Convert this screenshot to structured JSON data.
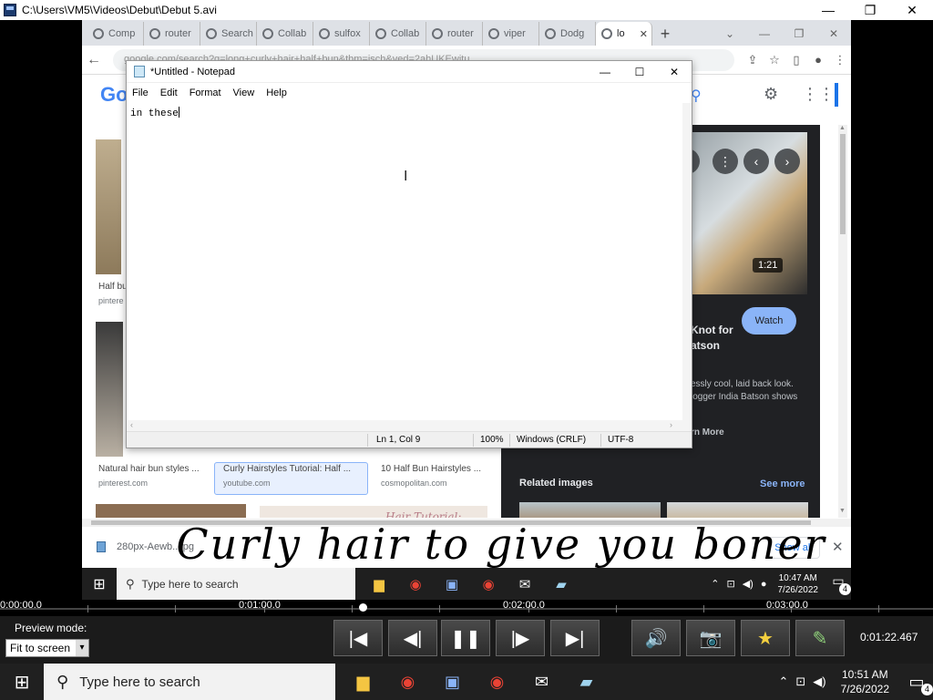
{
  "player": {
    "title": "C:\\Users\\VM5\\Videos\\Debut\\Debut 5.avi",
    "minimize": "—",
    "restore": "❐",
    "close": "✕"
  },
  "browser": {
    "tabs": [
      {
        "label": "Comp",
        "icon": "globe-icon"
      },
      {
        "label": "router",
        "icon": "globe-icon"
      },
      {
        "label": "Search",
        "icon": "globe-icon"
      },
      {
        "label": "Collab",
        "icon": "globe-icon"
      },
      {
        "label": "sulfox",
        "icon": "google-icon"
      },
      {
        "label": "Collab",
        "icon": "globe-icon"
      },
      {
        "label": "router",
        "icon": "globe-icon"
      },
      {
        "label": "viper",
        "icon": "google-icon"
      },
      {
        "label": "Dodg",
        "icon": "wikipedia-icon"
      },
      {
        "label": "lo",
        "icon": "google-icon",
        "active": true
      }
    ],
    "url": "google.com/search?q=long+curly+hair+half+bun&tbm=isch&ved=2ahUKEwitu..."
  },
  "google": {
    "logo": "Go",
    "results": [
      {
        "caption": "Half bu",
        "source": "pintere"
      },
      {
        "caption": "Natural hair bun styles ...",
        "source": "pinterest.com"
      },
      {
        "caption": "Curly Hairstyles Tutorial: Half ...",
        "source": "youtube.com"
      },
      {
        "caption": "10 Half Bun Hairstyles ...",
        "source": "cosmopolitan.com"
      }
    ],
    "thumb_text": "Hair Tutorial:",
    "panel": {
      "duration": "1:21",
      "watch": "Watch",
      "title": "Knot for\natson",
      "description": "essly cool, laid back look. logger India Batson shows",
      "learn_more": "rn More",
      "related": "Related images",
      "see_more": "See more"
    }
  },
  "notepad": {
    "title": "*Untitled - Notepad",
    "menu": [
      "File",
      "Edit",
      "Format",
      "View",
      "Help"
    ],
    "content": "in these",
    "status": {
      "position": "Ln 1, Col 9",
      "zoom": "100%",
      "line_ending": "Windows (CRLF)",
      "encoding": "UTF-8"
    }
  },
  "download": {
    "filename": "280px-Aewb...jpg",
    "show_all": "Show all"
  },
  "subtitle": "Curly hair to give you boner",
  "inner_taskbar": {
    "search_placeholder": "Type here to search",
    "time": "10:47 AM",
    "date": "7/26/2022",
    "notifications": "4"
  },
  "timeline": {
    "labels": [
      "0:00:00.0",
      "0:01:00.0",
      "0:02:00.0",
      "0:03:00.0"
    ],
    "position": "0:01:22.467"
  },
  "controls": {
    "preview_label": "Preview mode:",
    "preview_value": "Fit to screen"
  },
  "outer_taskbar": {
    "search_placeholder": "Type here to search",
    "time": "10:51 AM",
    "date": "7/26/2022",
    "notifications": "4"
  }
}
